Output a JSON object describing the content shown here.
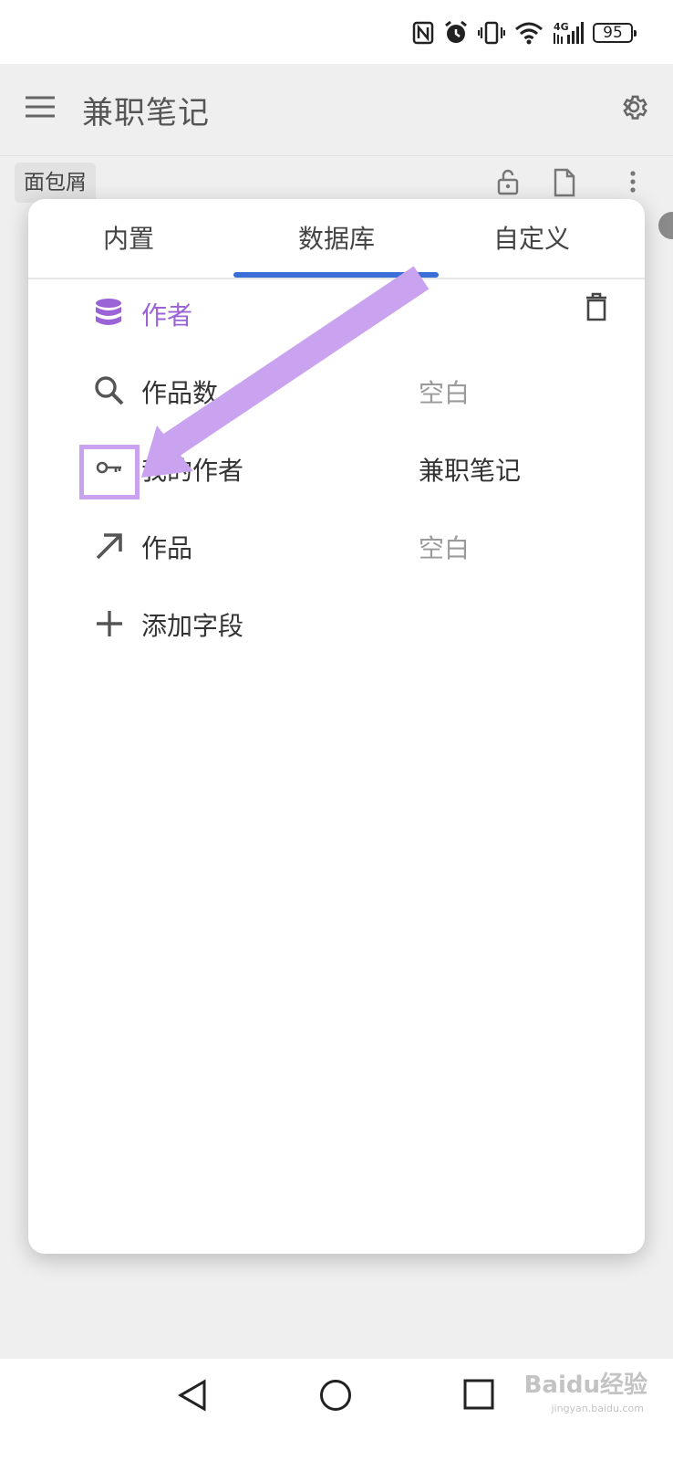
{
  "status_bar": {
    "battery": "95",
    "network": "4G",
    "icons": [
      "nfc-icon",
      "alarm-icon",
      "vibrate-icon",
      "wifi-icon",
      "signal-icon",
      "battery-icon"
    ]
  },
  "app_bar": {
    "title": "兼职笔记",
    "menu_icon": "menu-icon",
    "settings_icon": "gear-icon"
  },
  "toolbar": {
    "breadcrumb": "面包屑",
    "icons": [
      "unlock-icon",
      "document-icon",
      "more-vert-icon"
    ]
  },
  "panel": {
    "tabs": [
      {
        "label": "内置",
        "selected": false
      },
      {
        "label": "数据库",
        "selected": true
      },
      {
        "label": "自定义",
        "selected": false
      }
    ],
    "database": {
      "name": "作者",
      "icon": "database-icon"
    },
    "fields": [
      {
        "icon": "search-icon",
        "label": "作品数",
        "value": "空白"
      },
      {
        "icon": "key-icon",
        "label": "我的作者",
        "value": "兼职笔记"
      },
      {
        "icon": "arrow-up-right-icon",
        "label": "作品",
        "value": "空白"
      }
    ],
    "add_field": "添加字段",
    "accent_color": "#9a63d6",
    "tab_indicator_color": "#3a6fd8"
  },
  "annotation": {
    "color": "#c9a3ef"
  },
  "nav_bar": {
    "icons": [
      "back-icon",
      "home-icon",
      "recents-icon"
    ]
  },
  "watermark": {
    "text": "Baidu经验",
    "sub": "jingyan.baidu.com"
  }
}
